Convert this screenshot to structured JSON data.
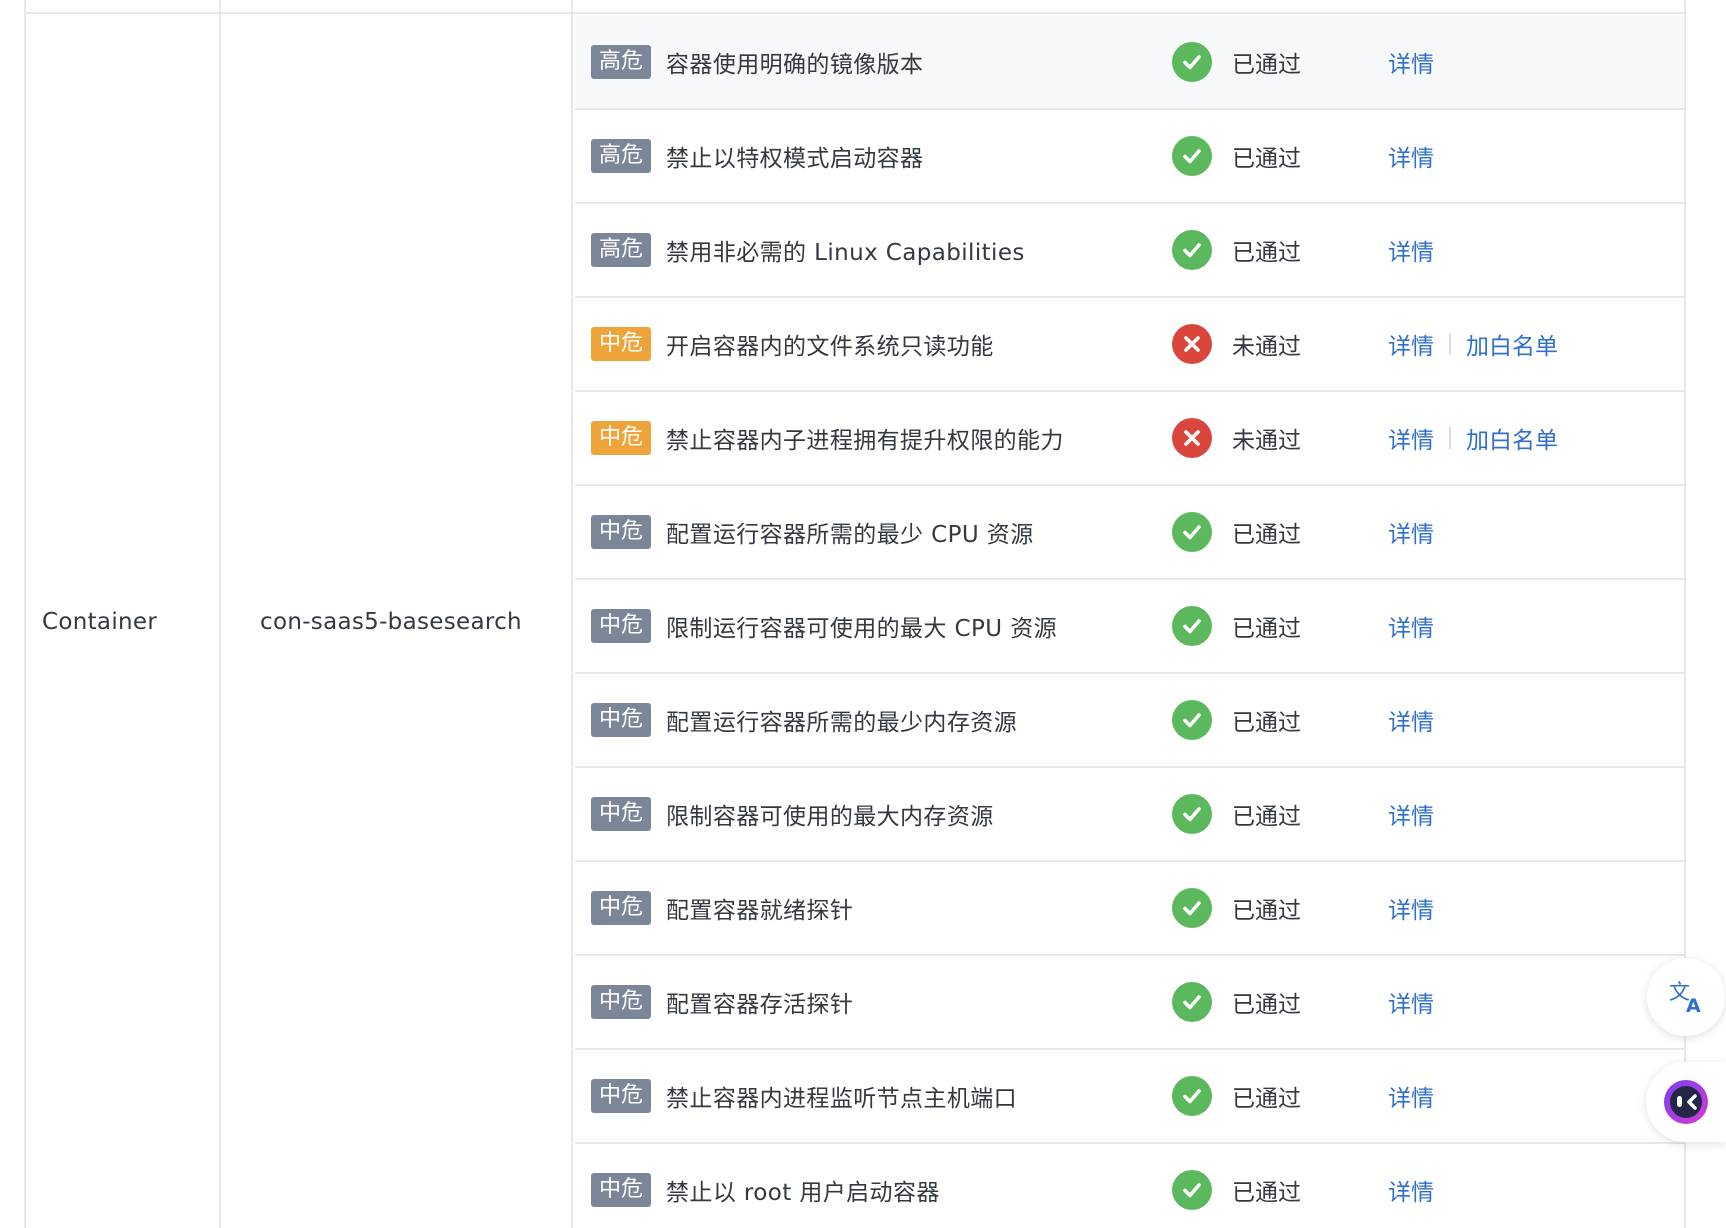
{
  "resource_type": "Container",
  "resource_name": "con-saas5-basesearch",
  "rows": [
    {
      "level": "高危",
      "rule": "容器使用明确的镜像版本",
      "status": "已通过",
      "result": "pass",
      "detail": "详情"
    },
    {
      "level": "高危",
      "rule": "禁止以特权模式启动容器",
      "status": "已通过",
      "result": "pass",
      "detail": "详情"
    },
    {
      "level": "高危",
      "rule": "禁用非必需的 Linux Capabilities",
      "status": "已通过",
      "result": "pass",
      "detail": "详情"
    },
    {
      "level": "中危",
      "rule": "开启容器内的文件系统只读功能",
      "status": "未通过",
      "result": "fail",
      "detail": "详情",
      "whitelist": "加白名单"
    },
    {
      "level": "中危",
      "rule": "禁止容器内子进程拥有提升权限的能力",
      "status": "未通过",
      "result": "fail",
      "detail": "详情",
      "whitelist": "加白名单"
    },
    {
      "level": "中危",
      "rule": "配置运行容器所需的最少 CPU 资源",
      "status": "已通过",
      "result": "pass",
      "detail": "详情"
    },
    {
      "level": "中危",
      "rule": "限制运行容器可使用的最大 CPU 资源",
      "status": "已通过",
      "result": "pass",
      "detail": "详情"
    },
    {
      "level": "中危",
      "rule": "配置运行容器所需的最少内存资源",
      "status": "已通过",
      "result": "pass",
      "detail": "详情"
    },
    {
      "level": "中危",
      "rule": "限制容器可使用的最大内存资源",
      "status": "已通过",
      "result": "pass",
      "detail": "详情"
    },
    {
      "level": "中危",
      "rule": "配置容器就绪探针",
      "status": "已通过",
      "result": "pass",
      "detail": "详情"
    },
    {
      "level": "中危",
      "rule": "配置容器存活探针",
      "status": "已通过",
      "result": "pass",
      "detail": "详情"
    },
    {
      "level": "中危",
      "rule": "禁止容器内进程监听节点主机端口",
      "status": "已通过",
      "result": "pass",
      "detail": "详情"
    },
    {
      "level": "中危",
      "rule": "禁止以 root 用户启动容器",
      "status": "已通过",
      "result": "pass",
      "detail": "详情"
    }
  ],
  "colors": {
    "pass": "#5cb85c",
    "fail": "#d9463b",
    "link": "#2f6fce",
    "tag_gray": "#7b8799",
    "tag_orange": "#efa43a"
  },
  "floating": {
    "translate_icon": "translate-icon",
    "assistant_icon": "assistant-icon"
  }
}
